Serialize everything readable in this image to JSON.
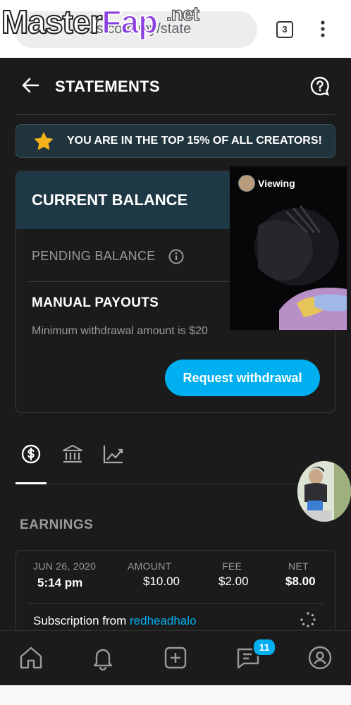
{
  "browser": {
    "url_text": "...s.com/my/state",
    "tab_count": "3",
    "watermark": {
      "part1": "Master",
      "part2": "Fap",
      "net": ".net"
    }
  },
  "header": {
    "title": "STATEMENTS"
  },
  "banner": {
    "text": "YOU ARE IN THE TOP 15% OF ALL CREATORS!"
  },
  "balance": {
    "title": "CURRENT BALANCE",
    "pending_label": "PENDING BALANCE",
    "manual_payouts": "MANUAL PAYOUTS",
    "minimum_text": "Minimum withdrawal amount is $20",
    "withdraw_button": "Request withdrawal"
  },
  "overlay": {
    "label": "Viewing"
  },
  "tabs": [
    {
      "icon": "dollar-circle-icon"
    },
    {
      "icon": "bank-icon"
    },
    {
      "icon": "chart-line-icon"
    }
  ],
  "earnings": {
    "title": "EARNINGS",
    "columns": {
      "date_header": "JUN 26, 2020",
      "amount_header": "AMOUNT",
      "fee_header": "FEE",
      "net_header": "NET"
    },
    "row": {
      "time": "5:14 pm",
      "amount": "$10.00",
      "fee": "$2.00",
      "net": "$8.00",
      "description_prefix": "Subscription from ",
      "username": "redheadhalo"
    }
  },
  "bottom_nav": {
    "items": [
      "home-icon",
      "bell-icon",
      "plus-square-icon",
      "messages-icon",
      "profile-icon"
    ],
    "messages_badge": "11"
  },
  "colors": {
    "accent": "#00aff0",
    "background": "#1b1b1b",
    "star": "#f6b21b"
  }
}
